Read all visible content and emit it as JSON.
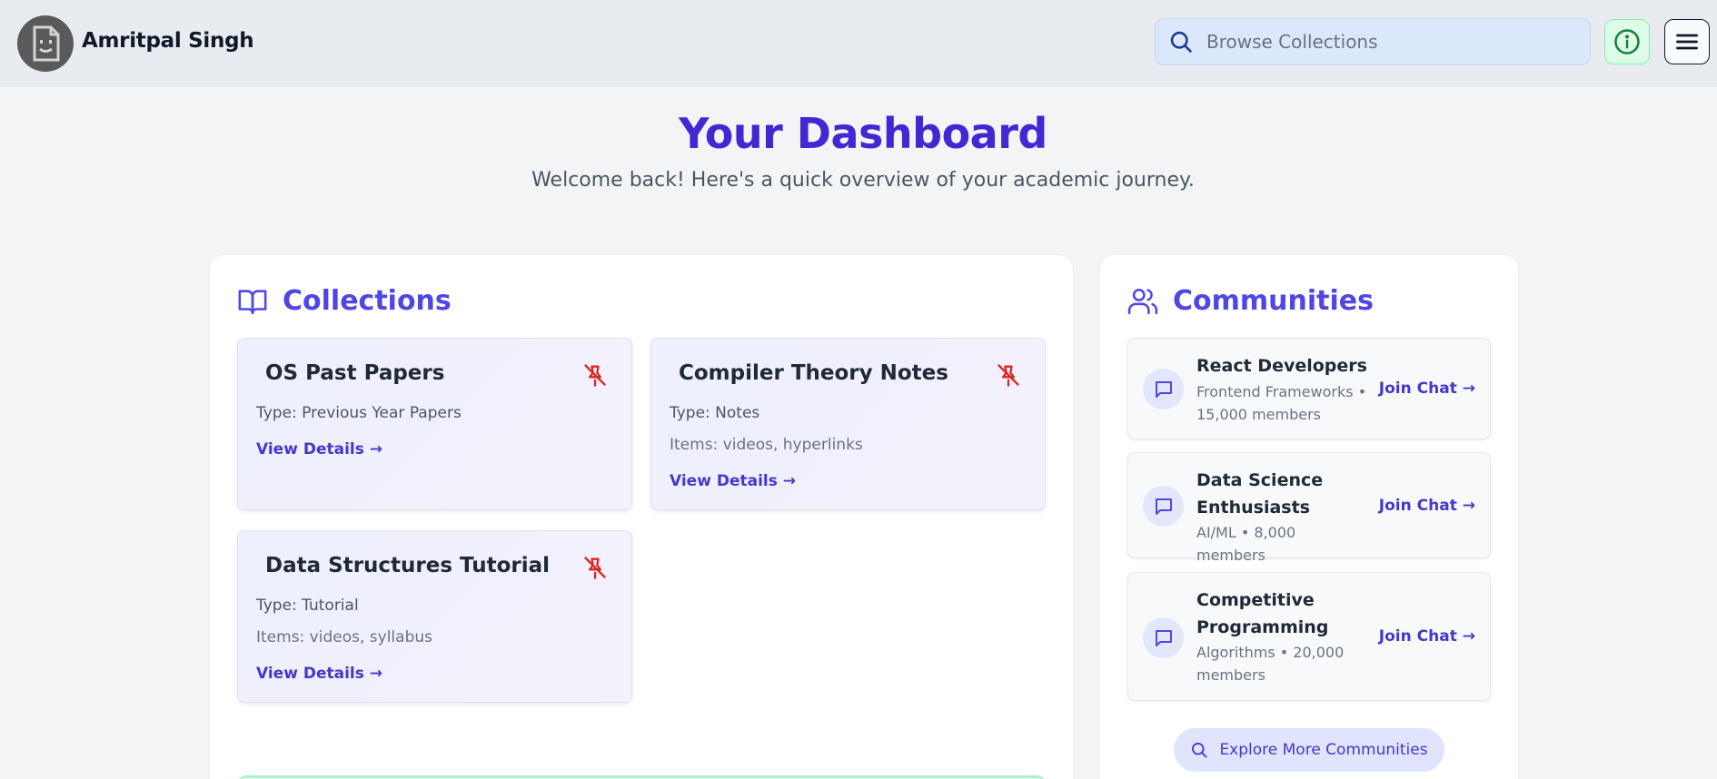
{
  "header": {
    "username": "Amritpal Singh",
    "search_placeholder": "Browse Collections",
    "icons": {
      "avatar": "avatar-face-icon",
      "search": "search-icon",
      "info": "info-icon",
      "menu": "menu-icon"
    }
  },
  "dashboard": {
    "title": "Your Dashboard",
    "subtitle": "Welcome back! Here's a quick overview of your academic journey."
  },
  "collections": {
    "heading": "Collections",
    "heading_icon": "book-open-icon",
    "items": [
      {
        "title": "OS Past Papers",
        "type": "Type: Previous Year Papers",
        "items": "",
        "link": "View Details →"
      },
      {
        "title": "Compiler Theory Notes",
        "type": "Type: Notes",
        "items": "Items: videos, hyperlinks",
        "link": "View Details →"
      },
      {
        "title": "Data Structures Tutorial",
        "type": "Type: Tutorial",
        "items": "Items: videos, syllabus",
        "link": "View Details →"
      }
    ],
    "pin_icon": "unpin-icon"
  },
  "communities": {
    "heading": "Communities",
    "heading_icon": "users-icon",
    "items": [
      {
        "name": "React Developers",
        "meta": "Frontend Frameworks • 15,000 members",
        "join": "Join Chat →"
      },
      {
        "name": "Data Science Enthusiasts",
        "meta": "AI/ML • 8,000 members",
        "join": "Join Chat →"
      },
      {
        "name": "Competitive Programming",
        "meta": "Algorithms • 20,000 members",
        "join": "Join Chat →"
      }
    ],
    "explore_label": "Explore More Communities"
  },
  "colors": {
    "accent": "#4f46e5",
    "title": "#4427d3",
    "pin": "#dc2626"
  }
}
